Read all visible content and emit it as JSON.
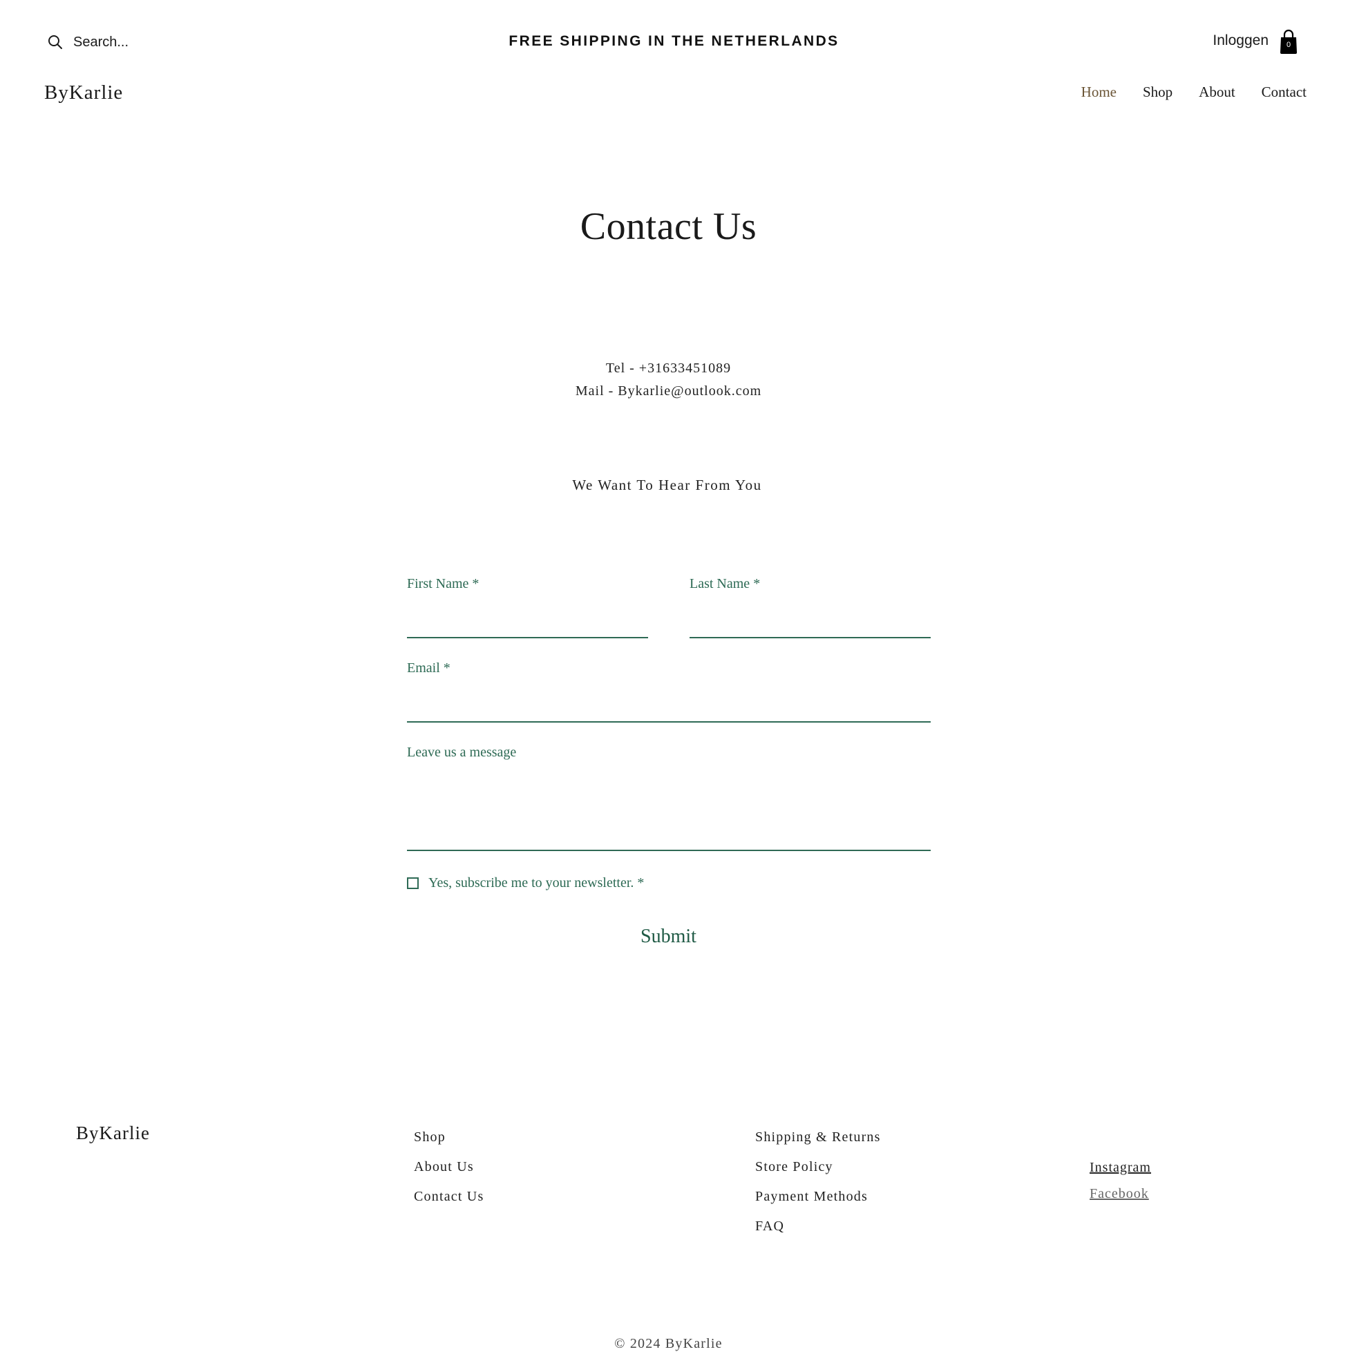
{
  "header": {
    "search_placeholder": "Search...",
    "announcement": "FREE SHIPPING IN THE NETHERLANDS",
    "login": "Inloggen",
    "cart_count": "0",
    "logo": "ByKarlie",
    "nav": [
      {
        "label": "Home",
        "active": true
      },
      {
        "label": "Shop",
        "active": false
      },
      {
        "label": "About",
        "active": false
      },
      {
        "label": "Contact",
        "active": false
      }
    ]
  },
  "main": {
    "title": "Contact Us",
    "tel": "Tel - +31633451089",
    "mail": "Mail - Bykarlie@outlook.com",
    "subtitle": "We Want To Hear From You",
    "form": {
      "first_name_label": "First Name *",
      "first_name_value": "",
      "last_name_label": "Last Name *",
      "last_name_value": "",
      "email_label": "Email *",
      "email_value": "",
      "message_label": "Leave us a message",
      "message_value": "",
      "newsletter_label": "Yes, subscribe me to your newsletter. *",
      "newsletter_checked": false,
      "submit_label": "Submit"
    }
  },
  "footer": {
    "logo": "ByKarlie",
    "col1": [
      "Shop",
      "About Us",
      "Contact Us"
    ],
    "col2": [
      "Shipping & Returns",
      "Store Policy",
      "Payment Methods",
      "FAQ"
    ],
    "social": [
      "Instagram",
      "Facebook"
    ],
    "copyright": "© 2024 ByKarlie"
  },
  "colors": {
    "accent_green": "#2d6a54",
    "nav_active": "#6b5536",
    "text": "#1a1a1a"
  },
  "icons": {
    "search": "search-icon",
    "cart": "shopping-bag-icon"
  }
}
